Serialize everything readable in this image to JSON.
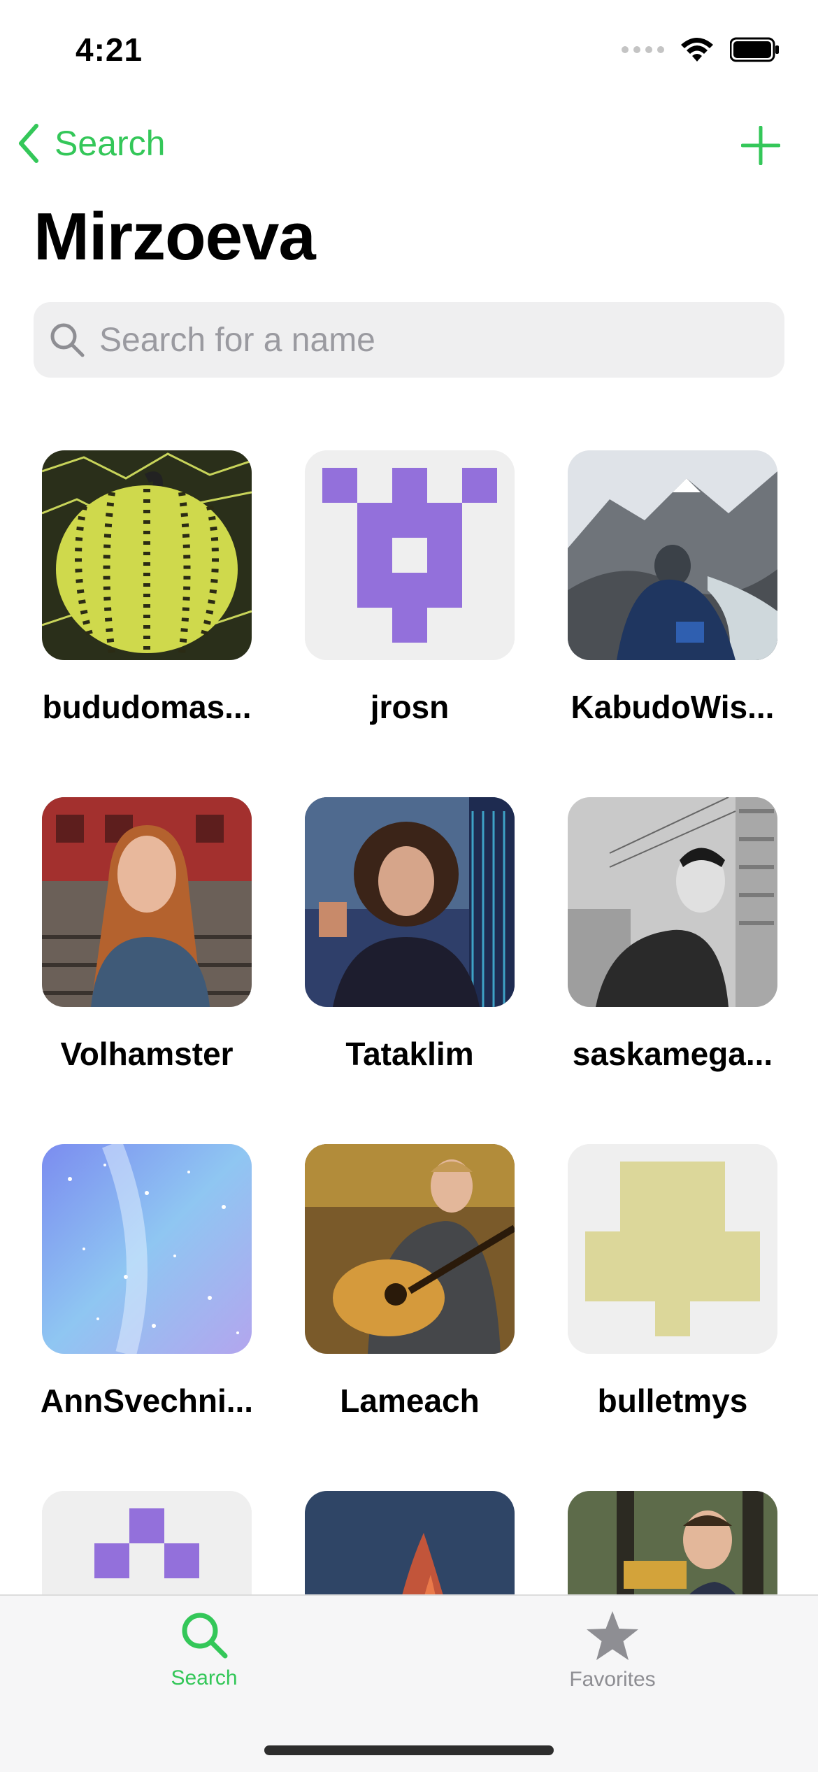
{
  "status_bar": {
    "time": "4:21"
  },
  "nav": {
    "back_label": "Search",
    "title": "Mirzoeva"
  },
  "search": {
    "placeholder": "Search for a name",
    "value": ""
  },
  "colors": {
    "accent": "#34c759",
    "inactive": "#8e8e93"
  },
  "users": [
    {
      "name": "bududomas...",
      "avatar": "yellow-pumpkin-photo"
    },
    {
      "name": "jrosn",
      "avatar": "purple-identicon"
    },
    {
      "name": "KabudoWis...",
      "avatar": "mountain-river-photo"
    },
    {
      "name": "Volhamster",
      "avatar": "redhead-railway-photo"
    },
    {
      "name": "Tataklim",
      "avatar": "curly-hair-city-photo"
    },
    {
      "name": "saskamega...",
      "avatar": "black-white-portrait-photo"
    },
    {
      "name": "AnnSvechni...",
      "avatar": "blue-galaxy-image"
    },
    {
      "name": "Lameach",
      "avatar": "guitar-player-photo"
    },
    {
      "name": "bulletmys",
      "avatar": "khaki-identicon"
    },
    {
      "name": "",
      "avatar": "purple-identicon-small"
    },
    {
      "name": "",
      "avatar": "fire-sky-photo"
    },
    {
      "name": "",
      "avatar": "park-bench-photo"
    }
  ],
  "tabs": [
    {
      "label": "Search",
      "icon": "magnifier-icon",
      "active": true
    },
    {
      "label": "Favorites",
      "icon": "star-icon",
      "active": false
    }
  ]
}
